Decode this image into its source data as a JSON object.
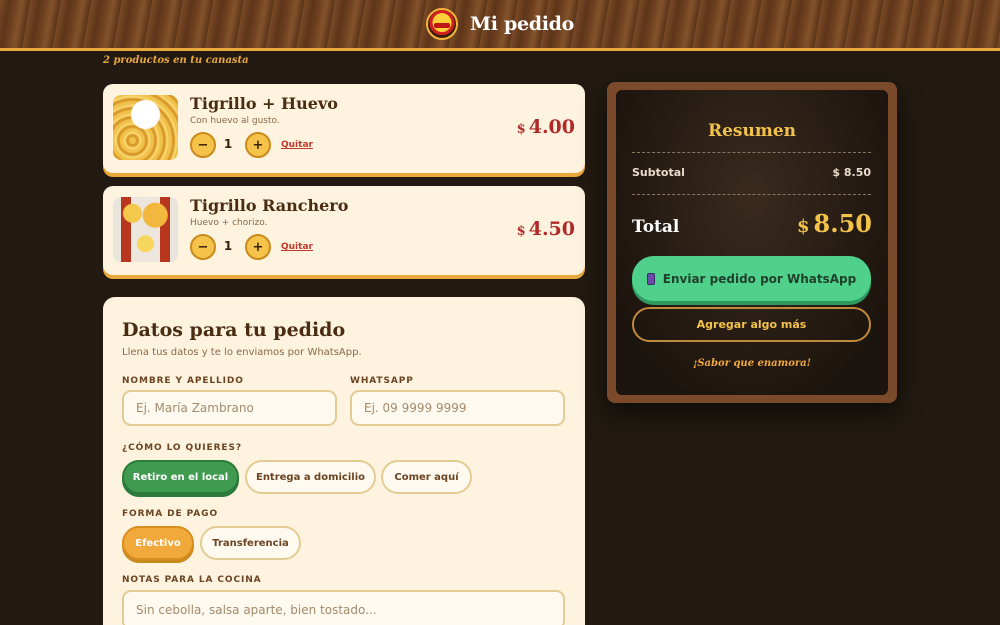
{
  "header": {
    "title": "Mi pedido",
    "logo_icon": "restaurant-logo-icon"
  },
  "cart": {
    "count_text": "2 productos en tu canasta",
    "items": [
      {
        "name": "Tigrillo + Huevo",
        "desc": "Con huevo al gusto.",
        "qty": "1",
        "currency": "$",
        "price": "4.00",
        "remove": "Quitar",
        "minus": "−",
        "plus": "+"
      },
      {
        "name": "Tigrillo Ranchero",
        "desc": "Huevo + chorizo.",
        "qty": "1",
        "currency": "$",
        "price": "4.50",
        "remove": "Quitar",
        "minus": "−",
        "plus": "+"
      }
    ]
  },
  "form": {
    "title": "Datos para tu pedido",
    "subtitle": "Llena tus datos y te lo enviamos por WhatsApp.",
    "name_label": "NOMBRE Y APELLIDO",
    "name_placeholder": "Ej. María Zambrano",
    "whatsapp_label": "WHATSAPP",
    "whatsapp_placeholder": "Ej. 09 9999 9999",
    "mode_label": "¿CÓMO LO QUIERES?",
    "modes": [
      "Retiro en el local",
      "Entrega a domicilio",
      "Comer aquí"
    ],
    "mode_selected": "Retiro en el local",
    "payment_label": "FORMA DE PAGO",
    "payments": [
      "Efectivo",
      "Transferencia"
    ],
    "payment_selected": "Efectivo",
    "notes_label": "NOTAS PARA LA COCINA",
    "notes_placeholder": "Sin cebolla, salsa aparte, bien tostado..."
  },
  "summary": {
    "title": "Resumen",
    "subtotal_label": "Subtotal",
    "subtotal_value": "$ 8.50",
    "total_label": "Total",
    "total_currency": "$",
    "total_value": "8.50",
    "whatsapp_button": "Enviar pedido por WhatsApp",
    "add_more_button": "Agregar algo más",
    "tagline": "¡Sabor que enamora!"
  },
  "colors": {
    "accent": "#e9a83c",
    "whatsapp": "#4fd18b",
    "price": "#b12a2a",
    "selected_mode": "#3f9b4f",
    "selected_payment": "#f2a93b"
  }
}
